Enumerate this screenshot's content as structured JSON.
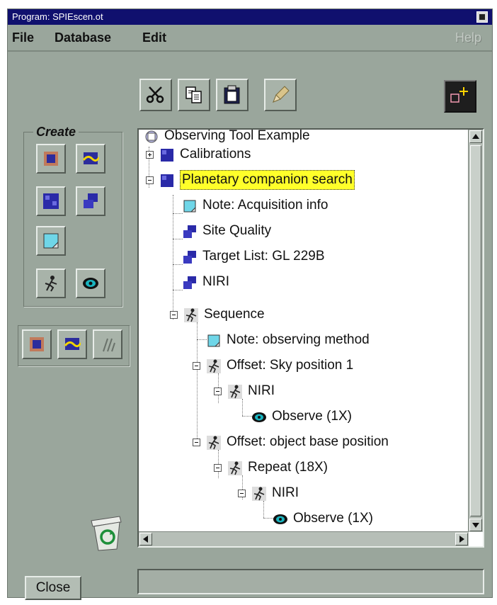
{
  "window": {
    "title": "Program: SPIEscen.ot"
  },
  "menu": {
    "file": "File",
    "database": "Database",
    "edit": "Edit",
    "help": "Help"
  },
  "toolbar": {
    "cut_icon": "scissors-icon",
    "copy_icon": "copy-icon",
    "paste_icon": "clipboard-icon",
    "edit_icon": "pencil-icon",
    "position_editor_icon": "crosshair-icon"
  },
  "create": {
    "label": "Create",
    "items": [
      "observation-icon",
      "group-icon",
      "target-icon",
      "instrument-icon",
      "note-icon",
      "sequence-icon",
      "observe-eye-icon"
    ]
  },
  "tree": {
    "root": "Observing Tool Example",
    "calibrations": "Calibrations",
    "planetary": "Planetary companion search",
    "note_acq": "Note: Acquisition info",
    "site_quality": "Site Quality",
    "target_list": "Target List: GL 229B",
    "niri1": "NIRI",
    "sequence": "Sequence",
    "note_obs": "Note: observing method",
    "offset_sky": "Offset: Sky position 1",
    "niri2": "NIRI",
    "observe1": "Observe (1X)",
    "offset_obj": "Offset: object base position",
    "repeat": "Repeat (18X)",
    "niri3": "NIRI",
    "observe2": "Observe (1X)"
  },
  "footer": {
    "close": "Close",
    "status": ""
  },
  "colors": {
    "selected_bg": "#ffff2a",
    "titlebar": "#10106e",
    "panel": "#9aa69c"
  }
}
